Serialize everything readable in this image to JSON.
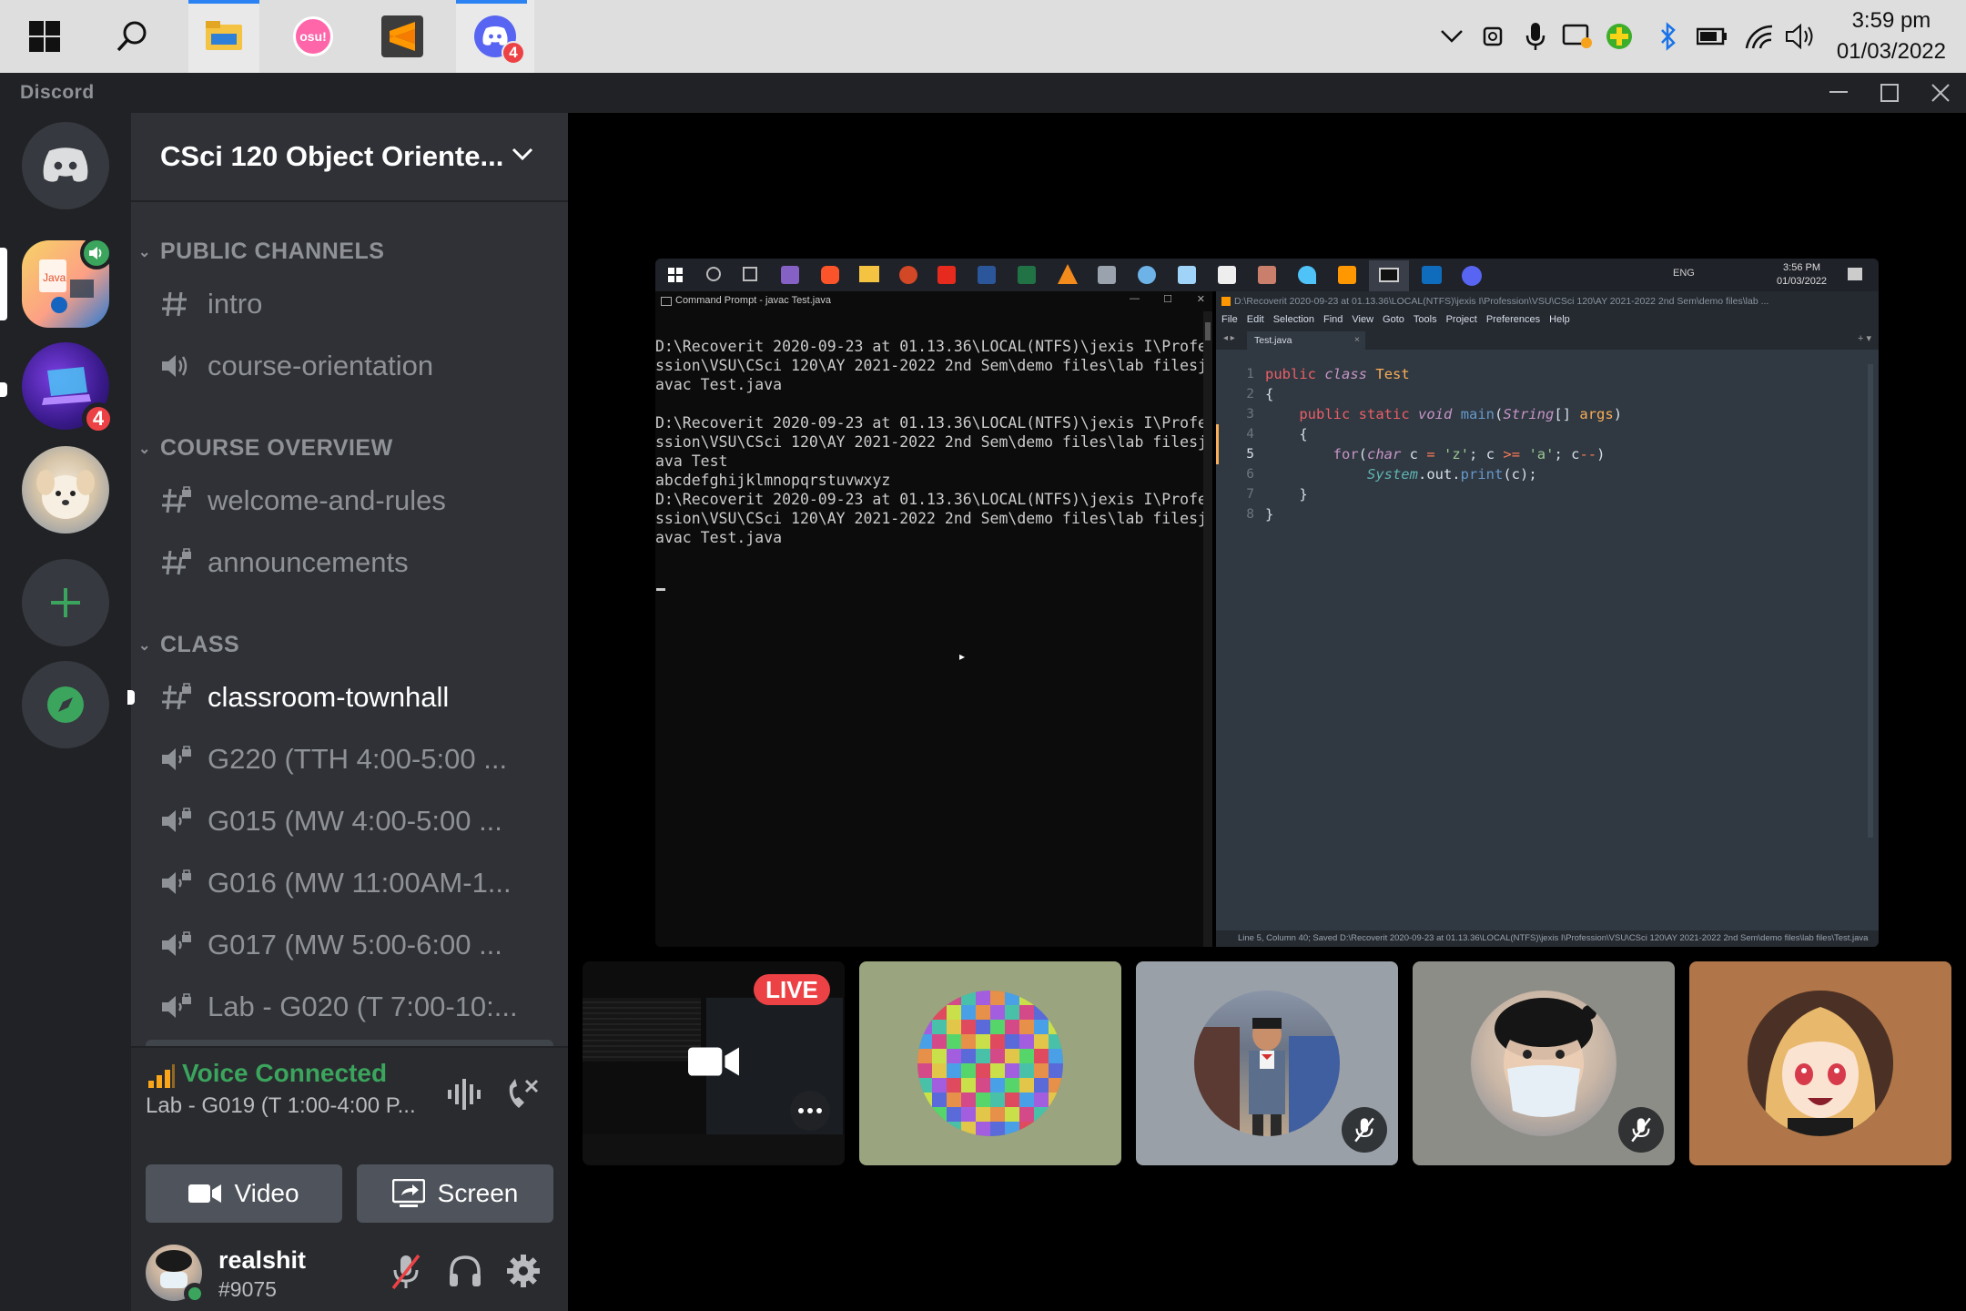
{
  "taskbar": {
    "apps": [
      "windows-start",
      "search",
      "file-explorer",
      "osu",
      "sublime-text",
      "discord"
    ],
    "osu_label": "osu!",
    "discord_badge": "4",
    "clock_time": "3:59 pm",
    "clock_date": "01/03/2022"
  },
  "window": {
    "brand": "Discord"
  },
  "servers": {
    "badge_count": "4"
  },
  "guild": {
    "name": "CSci 120 Object Oriente..."
  },
  "categories": {
    "public": "PUBLIC CHANNELS",
    "overview": "COURSE OVERVIEW",
    "class": "CLASS"
  },
  "channels": [
    {
      "name": "intro",
      "type": "text"
    },
    {
      "name": "course-orientation",
      "type": "voice"
    },
    {
      "name": "welcome-and-rules",
      "type": "text-locked"
    },
    {
      "name": "announcements",
      "type": "text-locked"
    },
    {
      "name": "classroom-townhall",
      "type": "text-locked"
    },
    {
      "name": "G220 (TTH 4:00-5:00 ...",
      "type": "voice-locked"
    },
    {
      "name": "G015 (MW 4:00-5:00 ...",
      "type": "voice-locked"
    },
    {
      "name": "G016 (MW 11:00AM-1...",
      "type": "voice-locked"
    },
    {
      "name": "G017 (MW 5:00-6:00 ...",
      "type": "voice-locked"
    },
    {
      "name": "Lab - G020 (T 7:00-10:...",
      "type": "voice-locked"
    }
  ],
  "voice": {
    "status": "Voice Connected",
    "channel": "Lab - G019 (T 1:00-4:00 P...",
    "video_label": "Video",
    "screen_label": "Screen"
  },
  "user": {
    "name": "realshit",
    "tag": "#9075"
  },
  "stream": {
    "live_label": "LIVE",
    "inner_clock_time": "3:56 PM",
    "inner_clock_date": "01/03/2022",
    "inner_lang": "ENG",
    "cmd_title": "Command Prompt - javac  Test.java",
    "cmd_lines": [
      "D:\\Recoverit 2020-09-23 at 01.13.36\\LOCAL(NTFS)\\jexis I\\Profe",
      "ssion\\VSU\\CSci 120\\AY 2021-2022 2nd Sem\\demo files\\lab filesj",
      "avac Test.java",
      "",
      "D:\\Recoverit 2020-09-23 at 01.13.36\\LOCAL(NTFS)\\jexis I\\Profe",
      "ssion\\VSU\\CSci 120\\AY 2021-2022 2nd Sem\\demo files\\lab filesj",
      "ava Test",
      "abcdefghijklmnopqrstuvwxyz",
      "D:\\Recoverit 2020-09-23 at 01.13.36\\LOCAL(NTFS)\\jexis I\\Profe",
      "ssion\\VSU\\CSci 120\\AY 2021-2022 2nd Sem\\demo files\\lab filesj",
      "avac Test.java"
    ],
    "editor_title": "D:\\Recoverit 2020-09-23 at 01.13.36\\LOCAL(NTFS)\\jexis I\\Profession\\VSU\\CSci 120\\AY 2021-2022 2nd Sem\\demo files\\lab ...",
    "editor_menu": [
      "File",
      "Edit",
      "Selection",
      "Find",
      "View",
      "Goto",
      "Tools",
      "Project",
      "Preferences",
      "Help"
    ],
    "editor_tab": "Test.java",
    "line_numbers": [
      "1",
      "2",
      "3",
      "4",
      "5",
      "6",
      "7",
      "8"
    ],
    "status_bar": "Line 5, Column 40; Saved D:\\Recoverit 2020-09-23 at 01.13.36\\LOCAL(NTFS)\\jexis I\\Profession\\VSU\\CSci 120\\AY 2021-2022 2nd Sem\\demo files\\lab files\\Test.java"
  },
  "colors": {
    "accent": "#5865f2",
    "green": "#3ba55d",
    "red": "#ed4245",
    "sidebar": "#2f3136",
    "rail": "#202225"
  }
}
